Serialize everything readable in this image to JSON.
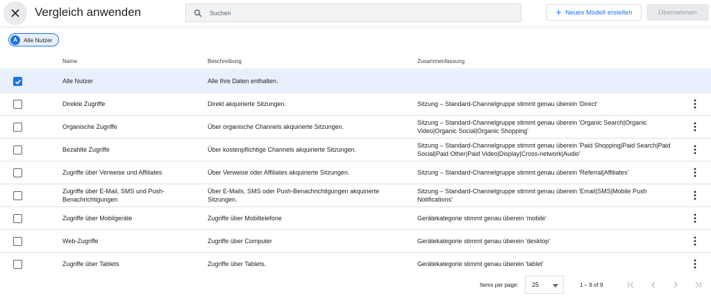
{
  "header": {
    "title": "Vergleich anwenden",
    "search_placeholder": "Suchen",
    "new_model_label": "Neues Modell erstellen",
    "apply_label": "Übernehmen"
  },
  "chip": {
    "avatar_letter": "A",
    "label": "Alle Nutzer"
  },
  "table": {
    "columns": {
      "name": "Name",
      "description": "Beschreibung",
      "summary": "Zusammenfassung"
    },
    "rows": [
      {
        "checked": true,
        "name": "Alle Nutzer",
        "description": "Alle Ihre Daten enthalten.",
        "summary": ""
      },
      {
        "checked": false,
        "name": "Direkte Zugriffe",
        "description": "Direkt akquirierte Sitzungen.",
        "summary": "Sitzung – Standard-Channelgruppe stimmt genau überein 'Direct'"
      },
      {
        "checked": false,
        "name": "Organische Zugriffe",
        "description": "Über organische Channels akquirierte Sitzungen.",
        "summary": "Sitzung – Standard-Channelgruppe stimmt genau überein 'Organic Search|Organic Video|Organic Social|Organic Shopping'"
      },
      {
        "checked": false,
        "name": "Bezahlte Zugriffe",
        "description": "Über kostenpflichtige Channels akquirierte Sitzungen.",
        "summary": "Sitzung – Standard-Channelgruppe stimmt genau überein 'Paid Shopping|Paid Search|Paid Social|Paid Other|Paid Video|Display|Cross-network|Audio'"
      },
      {
        "checked": false,
        "name": "Zugriffe über Verweise und Affiliates",
        "description": "Über Verweise oder Affiliates akquirierte Sitzungen.",
        "summary": "Sitzung – Standard-Channelgruppe stimmt genau überein 'Referral|Affiliates'"
      },
      {
        "checked": false,
        "name": "Zugriffe über E-Mail, SMS und Push-Benachrichtigungen",
        "description": "Über E-Mails, SMS oder Push-Benachrichtigungen akquirierte Sitzungen.",
        "summary": "Sitzung – Standard-Channelgruppe stimmt genau überein 'Email|SMS|Mobile Push Notifications'"
      },
      {
        "checked": false,
        "name": "Zugriffe über Mobilgeräte",
        "description": "Zugriffe über Mobiltelefone",
        "summary": "Gerätekategorie stimmt genau überein 'mobile'"
      },
      {
        "checked": false,
        "name": "Web-Zugriffe",
        "description": "Zugriffe über Computer",
        "summary": "Gerätekategorie stimmt genau überein 'desktop'"
      },
      {
        "checked": false,
        "name": "Zugriffe über Tablets",
        "description": "Zugriffe über Tablets.",
        "summary": "Gerätekategorie stimmt genau überein 'tablet'"
      }
    ]
  },
  "pagination": {
    "items_per_page_label": "Items per page:",
    "items_per_page_value": "25",
    "range_label": "1 – 9 of 9"
  },
  "colors": {
    "accent": "#1a73e8",
    "selected_row": "#e8f0fe",
    "disabled": "#9aa0a6"
  },
  "icons": [
    "close-icon",
    "search-icon",
    "plus-icon",
    "checkmark-icon",
    "more-vert-icon",
    "dropdown-arrow-icon",
    "first-page-icon",
    "prev-page-icon",
    "next-page-icon",
    "last-page-icon"
  ]
}
